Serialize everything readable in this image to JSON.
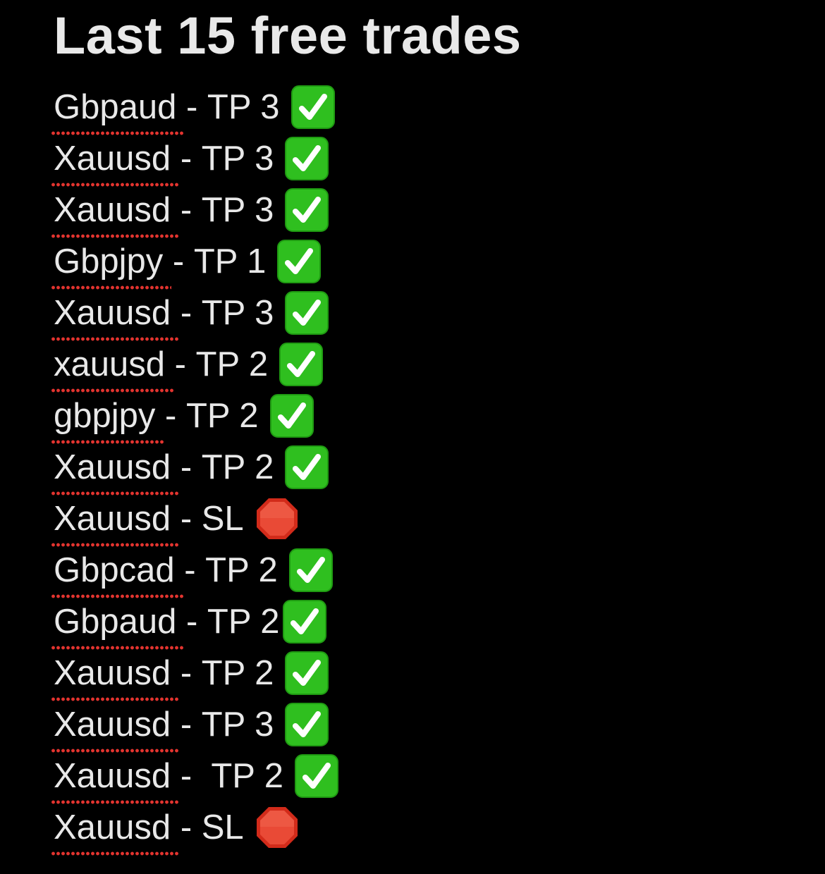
{
  "title": "Last 15 free trades",
  "colors": {
    "background": "#000000",
    "text": "#e8e8e8",
    "spellcheck_underline": "#e3342f",
    "check_green": "#2fbf1f",
    "stop_red": "#d22b1a"
  },
  "trades": [
    {
      "pair": "Gbpaud",
      "separator": " - ",
      "result": "TP 3",
      "icon": "check-mark-button-icon"
    },
    {
      "pair": "Xauusd",
      "separator": " - ",
      "result": "TP 3",
      "icon": "check-mark-button-icon"
    },
    {
      "pair": "Xauusd",
      "separator": " - ",
      "result": "TP 3",
      "icon": "check-mark-button-icon"
    },
    {
      "pair": "Gbpjpy",
      "separator": " - ",
      "result": "TP 1",
      "icon": "check-mark-button-icon"
    },
    {
      "pair": "Xauusd",
      "separator": " - ",
      "result": "TP 3",
      "icon": "check-mark-button-icon"
    },
    {
      "pair": "xauusd",
      "separator": " - ",
      "result": "TP 2",
      "icon": "check-mark-button-icon"
    },
    {
      "pair": "gbpjpy",
      "separator": " - ",
      "result": "TP 2",
      "icon": "check-mark-button-icon"
    },
    {
      "pair": "Xauusd",
      "separator": " - ",
      "result": "TP 2",
      "icon": "check-mark-button-icon"
    },
    {
      "pair": "Xauusd",
      "separator": " - ",
      "result": "SL",
      "icon": "stop-sign-icon"
    },
    {
      "pair": "Gbpcad",
      "separator": " - ",
      "result": "TP 2",
      "icon": "check-mark-button-icon"
    },
    {
      "pair": "Gbpaud",
      "separator": " - ",
      "result": "TP 2",
      "icon": "check-mark-button-icon",
      "tight": true
    },
    {
      "pair": "Xauusd",
      "separator": " - ",
      "result": "TP 2",
      "icon": "check-mark-button-icon"
    },
    {
      "pair": "Xauusd",
      "separator": " - ",
      "result": "TP 3",
      "icon": "check-mark-button-icon"
    },
    {
      "pair": "Xauusd",
      "separator": " -  ",
      "result": "TP 2",
      "icon": "check-mark-button-icon"
    },
    {
      "pair": "Xauusd",
      "separator": " - ",
      "result": "SL",
      "icon": "stop-sign-icon"
    }
  ]
}
